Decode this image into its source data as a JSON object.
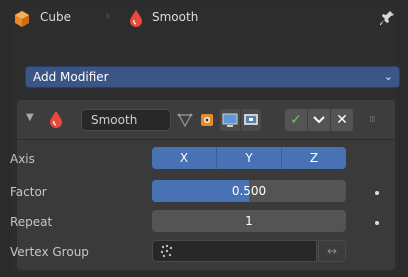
{
  "header": {
    "object_label": "Cube",
    "modifier_label": "Smooth",
    "object_icon": "cube-icon",
    "modifier_icon": "smooth-modifier-icon",
    "pin_icon": "pin-icon"
  },
  "add_modifier": {
    "label": "Add Modifier"
  },
  "modifier": {
    "name": "Smooth",
    "toggles": {
      "edit_mode": "edit-mode-icon",
      "on_cage": "on-cage-icon",
      "viewport": "viewport-icon",
      "render": "render-icon"
    },
    "axis": {
      "label": "Axis",
      "options": [
        "X",
        "Y",
        "Z"
      ]
    },
    "factor": {
      "label": "Factor",
      "value_text": "0.500",
      "value": 0.5
    },
    "repeat": {
      "label": "Repeat",
      "value_text": "1"
    },
    "vertex_group": {
      "label": "Vertex Group",
      "value": ""
    }
  },
  "colors": {
    "accent": "#4772b3",
    "panel": "#3a3a3a",
    "background": "#2d2d2d",
    "object_orange": "#e88a2a",
    "modifier_red": "#e84a3c"
  }
}
